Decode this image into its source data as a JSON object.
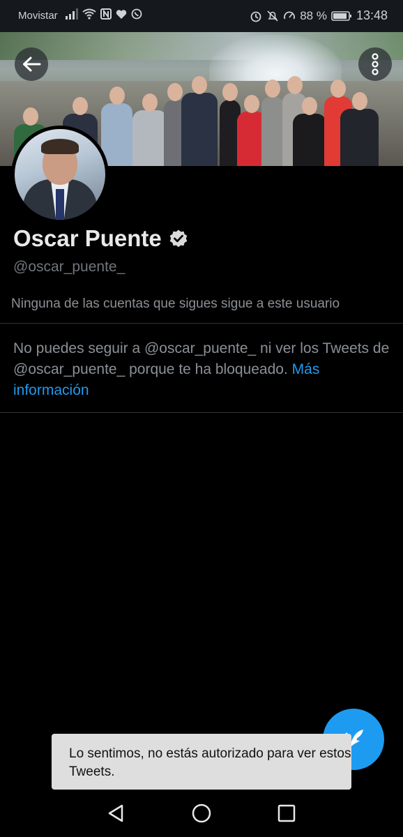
{
  "status_bar": {
    "carrier": "Movistar",
    "battery": "88 %",
    "time": "13:48"
  },
  "profile": {
    "name": "Oscar Puente",
    "handle": "@oscar_puente_",
    "followed_by_note": "Ninguna de las cuentas que sigues sigue a este usuario"
  },
  "blocked_notice": {
    "text": "No puedes seguir a @oscar_puente_ ni ver los Tweets de @oscar_puente_ porque te ha bloqueado.",
    "link": "Más información"
  },
  "toast": {
    "message": "Lo sentimos, no estás autorizado para ver estos Tweets."
  },
  "colors": {
    "accent": "#1d9bf0",
    "background": "#000000",
    "secondary_text": "#71767b"
  },
  "icons": {
    "back": "arrow-left-icon",
    "more": "vertical-dots-icon",
    "verified": "verified-badge-icon",
    "compose": "feather-plus-icon",
    "nav_back": "triangle-back-icon",
    "nav_home": "circle-home-icon",
    "nav_recents": "square-recents-icon"
  }
}
